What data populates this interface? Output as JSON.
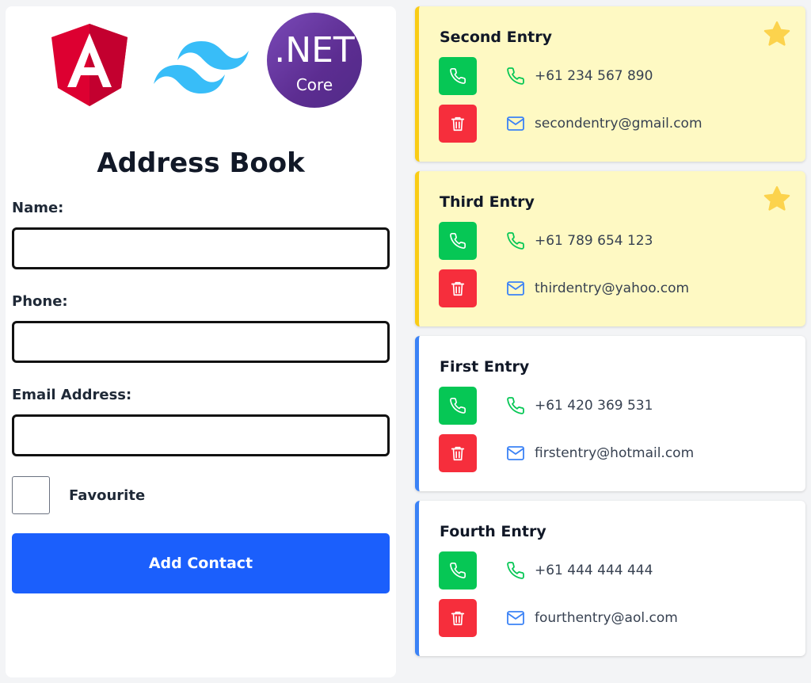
{
  "form": {
    "title": "Address Book",
    "name_label": "Name:",
    "name_value": "",
    "phone_label": "Phone:",
    "phone_value": "",
    "email_label": "Email Address:",
    "email_value": "",
    "favourite_label": "Favourite",
    "favourite_checked": false,
    "submit_label": "Add Contact"
  },
  "logos": {
    "dotnet_main": ".NET",
    "dotnet_sub": "Core",
    "angular_icon": "angular-logo",
    "tailwind_icon": "tailwind-logo"
  },
  "contacts": [
    {
      "name": "Second Entry",
      "phone": "+61 234 567 890",
      "email": "secondentry@gmail.com",
      "favourite": true
    },
    {
      "name": "Third Entry",
      "phone": "+61 789 654 123",
      "email": "thirdentry@yahoo.com",
      "favourite": true
    },
    {
      "name": "First Entry",
      "phone": "+61 420 369 531",
      "email": "firstentry@hotmail.com",
      "favourite": false
    },
    {
      "name": "Fourth Entry",
      "phone": "+61 444 444 444",
      "email": "fourthentry@aol.com",
      "favourite": false
    }
  ],
  "colors": {
    "primary_button": "#1b5ffc",
    "call_button": "#06c755",
    "delete_button": "#f62e3c",
    "favourite_bg": "#fef9c3",
    "favourite_border": "#facc15",
    "normal_border": "#3b82f6",
    "star": "#fcd34d"
  },
  "icons": {
    "call": "phone-icon",
    "delete": "trash-icon",
    "phone": "phone-icon",
    "email": "mail-icon",
    "favourite": "star-icon"
  }
}
